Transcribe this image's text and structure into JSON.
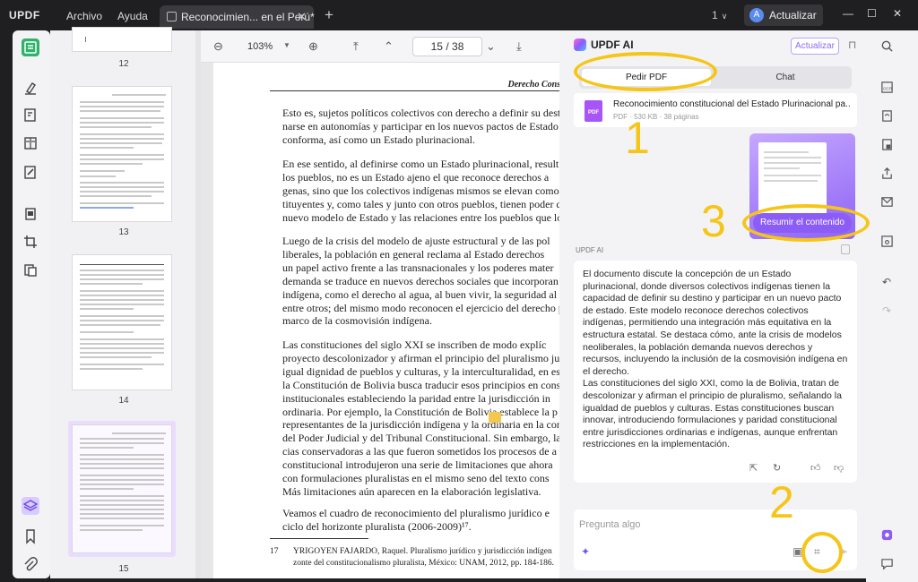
{
  "titlebar": {
    "logo": "UPDF",
    "menu_file": "Archivo",
    "menu_help": "Ayuda",
    "tab_title": "Reconocimien... en el Perú*",
    "tab_close": "✕",
    "tab_add": "+",
    "page_count": "1",
    "upgrade_avatar": "A",
    "upgrade_label": "Actualizar"
  },
  "thumbnails": [
    {
      "page_label": "12"
    },
    {
      "page_label": "13"
    },
    {
      "page_label": "14"
    },
    {
      "page_label": "15"
    }
  ],
  "viewer_toolbar": {
    "zoom": "103%",
    "current_page": "15",
    "total_pages": "38",
    "page_separator": "/"
  },
  "document": {
    "running_head": "Derecho Constitucional - Pág",
    "paragraphs": [
      [
        "Esto es, sujetos políticos colectivos con derecho a definir su desti",
        "narse en autonomías y participar en los nuevos pactos de Estado",
        "conforma, así como un Estado plurinacional."
      ],
      [
        "En ese sentido, al definirse como un Estado plurinacional, result",
        "los pueblos, no es un Estado ajeno el que reconoce derechos a",
        "genas, sino que los colectivos indígenas mismos se elevan como su",
        "tituyentes y, como tales y junto con otros pueblos, tienen poder de",
        "nuevo modelo de Estado y las relaciones entre los pueblos que lo c"
      ],
      [
        "Luego de la crisis del modelo de ajuste estructural y de las pol",
        "liberales, la población en general reclama al Estado derechos",
        "un papel activo frente a las transnacionales y los poderes mater",
        "demanda se traduce en nuevos derechos sociales que incorporan",
        "indígena, como el derecho al agua, al buen vivir, la seguridad al",
        "entre otros; del mismo modo reconocen el ejercicio del derecho p",
        "marco de la cosmovisión indígena."
      ],
      [
        "Las constituciones del siglo XXI se inscriben de modo explíc",
        "proyecto descolonizador y afirman el principio del pluralismo ju",
        "igual dignidad de pueblos y culturas, y la interculturalidad, en es",
        "la Constitución de Bolivia busca traducir esos principios en cons",
        "institucionales estableciendo la paridad entre la jurisdicción in",
        "ordinaria. Por ejemplo, la Constitución de Bolivia establece la p",
        "representantes de la jurisdicción indígena y la ordinaria en la con",
        "del Poder Judicial y del Tribunal Constitucional. Sin embargo, la",
        "cias conservadoras a las que fueron sometidos los procesos de a",
        "constitucional introdujeron una serie de limitaciones que ahora",
        "con formulaciones pluralistas en el mismo seno del texto cons",
        "Más limitaciones aún aparecen en la elaboración legislativa."
      ],
      [
        "Veamos el cuadro de reconocimiento del pluralismo jurídico e",
        "ciclo del horizonte pluralista (2006-2009)¹⁷."
      ]
    ],
    "footnote_number": "17",
    "footnote_lines": [
      "YRIGOYEN FAJARDO, Raquel. Pluralismo jurídico y jurisdicción indígen",
      "zonte del constitucionalismo pluralista, México: UNAM, 2012, pp. 184-186."
    ]
  },
  "ai_panel": {
    "title": "UPDF AI",
    "upgrade_label": "Actualizar",
    "tab_pdf": "Pedir PDF",
    "tab_chat": "Chat",
    "file_icon_text": "PDF",
    "file_name": "Reconocimiento constitucional del Estado Plurinacional pa...",
    "file_meta": "PDF · 530 KB · 38 páginas",
    "summarize_label": "Resumir el contenido",
    "response_label": "UPDF AI",
    "answer_lines": [
      "El documento discute la concepción de un Estado",
      "plurinacional, donde diversos colectivos indígenas tienen la",
      "capacidad de definir su destino y participar en un nuevo pacto",
      "de estado. Este modelo reconoce derechos colectivos",
      "indígenas, permitiendo una integración más equitativa en la",
      "estructura estatal. Se destaca cómo, ante la crisis de modelos",
      "neoliberales, la población demanda nuevos derechos y",
      "recursos, incluyendo la inclusión de la cosmovisión indígena en",
      "el derecho.",
      "Las constituciones del siglo XXI, como la de Bolivia, tratan de",
      "descolonizar y afirman el principio de pluralismo, señalando la",
      "igualdad de pueblos y culturas. Estas constituciones buscan",
      "innovar, introduciendo formulaciones y paridad constitucional",
      "entre jurisdicciones ordinarias e indígenas, aunque enfrentan",
      "restricciones en la implementación."
    ],
    "input_placeholder": "Pregunta algo"
  },
  "annotations": {
    "num1": "1",
    "num2": "2",
    "num3": "3",
    "color": "#f5c518"
  },
  "colors": {
    "accent_green": "#2fb36a",
    "accent_purple": "#8b5cf6"
  }
}
